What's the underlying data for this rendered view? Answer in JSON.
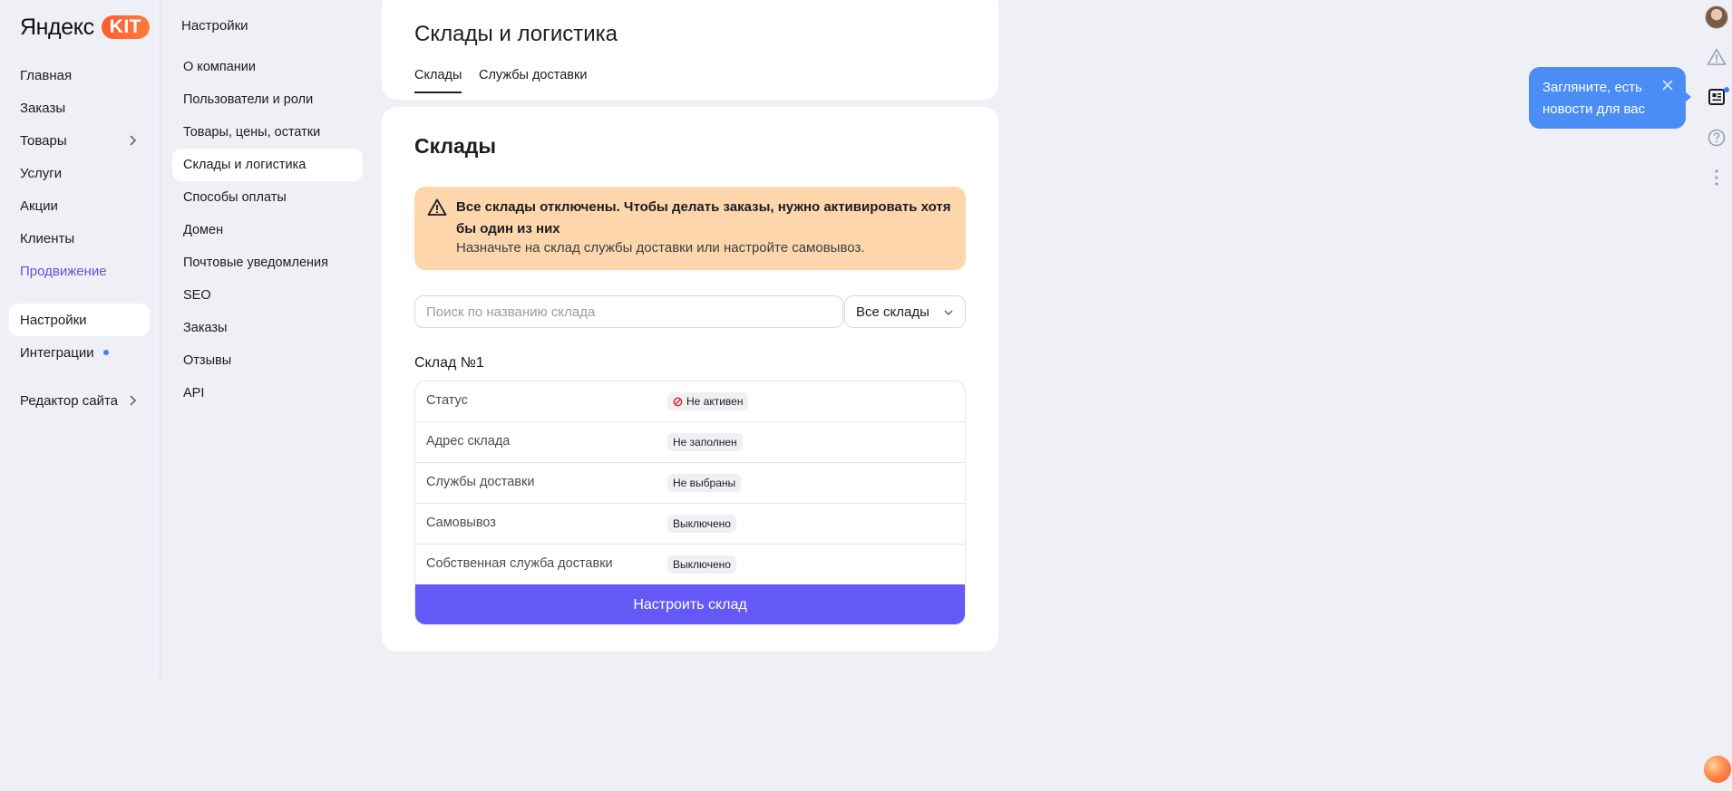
{
  "brand": {
    "name": "Яндекс",
    "badge": "KIT",
    "accent": "#ff6a35"
  },
  "nav": {
    "items": [
      {
        "label": "Главная"
      },
      {
        "label": "Заказы"
      },
      {
        "label": "Товары"
      },
      {
        "label": "Услуги"
      },
      {
        "label": "Акции"
      },
      {
        "label": "Клиенты"
      },
      {
        "label": "Продвижение"
      },
      {
        "label": "Настройки"
      },
      {
        "label": "Интеграции"
      },
      {
        "label": "Редактор сайта"
      }
    ],
    "active": "Настройки"
  },
  "subnav": {
    "title": "Настройки",
    "items": [
      {
        "label": "О компании"
      },
      {
        "label": "Пользователи и роли"
      },
      {
        "label": "Товары, цены, остатки"
      },
      {
        "label": "Склады и логистика"
      },
      {
        "label": "Способы оплаты"
      },
      {
        "label": "Домен"
      },
      {
        "label": "Почтовые уведомления"
      },
      {
        "label": "SEO"
      },
      {
        "label": "Заказы"
      },
      {
        "label": "Отзывы"
      },
      {
        "label": "API"
      }
    ],
    "active": "Склады и логистика"
  },
  "header": {
    "title": "Склады и логистика",
    "tabs": [
      {
        "label": "Склады"
      },
      {
        "label": "Службы доставки"
      }
    ],
    "active_tab": "Склады"
  },
  "main": {
    "section_title": "Склады",
    "alert": {
      "bold": "Все склады отключены. Чтобы делать заказы, нужно активировать хотя бы один из них",
      "text": "Назначьте на склад службы доставки или настройте самовывоз.",
      "color": "#fdd6ac"
    },
    "search": {
      "placeholder": "Поиск по названию склада",
      "value": ""
    },
    "filter": {
      "selected": "Все склады"
    },
    "warehouse": {
      "title": "Склад №1",
      "rows": [
        {
          "label": "Статус",
          "value": "Не активен",
          "icon": "stop-icon"
        },
        {
          "label": "Адрес склада",
          "value": "Не заполнен"
        },
        {
          "label": "Службы доставки",
          "value": "Не выбраны"
        },
        {
          "label": "Самовывоз",
          "value": "Выключено"
        },
        {
          "label": "Собственная служба доставки",
          "value": "Выключено"
        }
      ],
      "button": "Настроить склад",
      "button_color": "#6458f6"
    }
  },
  "right_rail": {
    "tooltip": "Загляните, есть новости для вас",
    "icons": [
      "avatar",
      "warning-icon",
      "news-icon",
      "help-icon",
      "more-icon"
    ]
  }
}
